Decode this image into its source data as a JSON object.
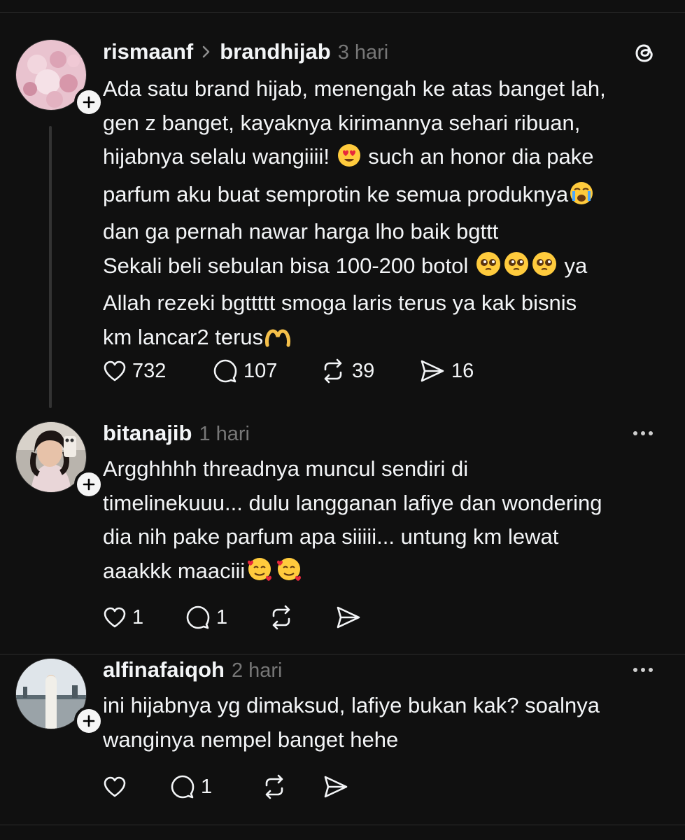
{
  "posts": [
    {
      "username": "rismaanf",
      "reply_to": "brandhijab",
      "time": "3 hari",
      "lines": [
        "Ada satu brand hijab, menengah ke atas banget lah,",
        "gen z banget, kayaknya kirimannya sehari ribuan,",
        "hijabnya selalu wangiiii!",
        "such an honor dia pake",
        "parfum aku buat semprotin ke semua produknya",
        "dan ga pernah nawar harga lho baik bgttt",
        "Sekali beli sebulan bisa 100-200 botol",
        "ya",
        "Allah rezeki bgttttt smoga laris terus ya kak bisnis",
        "km lancar2 terus"
      ],
      "likes": "732",
      "replies": "107",
      "reposts": "39",
      "shares": "16"
    },
    {
      "username": "bitanajib",
      "time": "1 hari",
      "lines": [
        "Argghhhh threadnya muncul sendiri di",
        "timelinekuuu... dulu langganan lafiye dan wondering",
        "dia nih pake parfum apa siiiii... untung km lewat",
        "aaakkk maaciii"
      ],
      "likes": "1",
      "replies": "1"
    },
    {
      "username": "alfinafaiqoh",
      "time": "2 hari",
      "lines": [
        "ini hijabnya yg dimaksud, lafiye bukan kak? soalnya",
        "wanginya nempel banget hehe"
      ],
      "replies": "1"
    }
  ],
  "icons": {
    "like": "heart-icon",
    "reply": "comment-bubble-icon",
    "repost": "repost-arrows-icon",
    "share": "send-paper-plane-icon",
    "more": "more-dots-icon",
    "brand": "threads-logo-icon",
    "follow": "plus-icon"
  },
  "colors": {
    "background": "#101010",
    "text": "#f3f5f7",
    "muted": "#777777"
  }
}
